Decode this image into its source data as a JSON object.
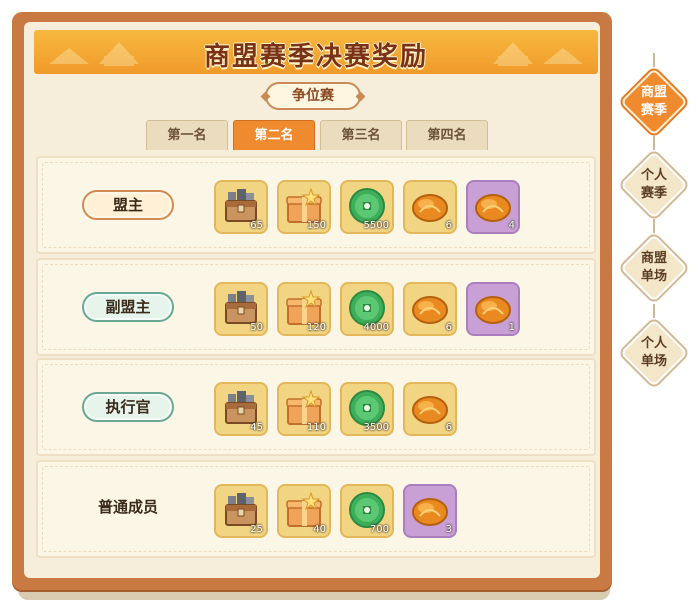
{
  "title": "商盟赛季决赛奖励",
  "mode_label": "争位赛",
  "tabs": [
    {
      "label": "第一名",
      "active": false
    },
    {
      "label": "第二名",
      "active": true
    },
    {
      "label": "第三名",
      "active": false
    },
    {
      "label": "第四名",
      "active": false
    }
  ],
  "side_tabs": [
    {
      "line1": "商盟",
      "line2": "赛季",
      "active": true
    },
    {
      "line1": "个人",
      "line2": "赛季",
      "active": false
    },
    {
      "line1": "商盟",
      "line2": "单场",
      "active": false
    },
    {
      "line1": "个人",
      "line2": "单场",
      "active": false
    }
  ],
  "rows": [
    {
      "role": "盟主",
      "badge": "gold",
      "items": [
        {
          "icon": "treasure-chest-icon",
          "qty": "65"
        },
        {
          "icon": "gift-box-icon",
          "qty": "150"
        },
        {
          "icon": "jade-coin-icon",
          "qty": "5500"
        },
        {
          "icon": "amber-stone-icon",
          "qty": "6"
        },
        {
          "icon": "amber-stone-rare-icon",
          "qty": "4"
        }
      ]
    },
    {
      "role": "副盟主",
      "badge": "teal",
      "items": [
        {
          "icon": "treasure-chest-icon",
          "qty": "50"
        },
        {
          "icon": "gift-box-icon",
          "qty": "120"
        },
        {
          "icon": "jade-coin-icon",
          "qty": "4000"
        },
        {
          "icon": "amber-stone-icon",
          "qty": "6"
        },
        {
          "icon": "amber-stone-rare-icon",
          "qty": "1"
        }
      ]
    },
    {
      "role": "执行官",
      "badge": "teal",
      "items": [
        {
          "icon": "treasure-chest-icon",
          "qty": "45"
        },
        {
          "icon": "gift-box-icon",
          "qty": "110"
        },
        {
          "icon": "jade-coin-icon",
          "qty": "3500"
        },
        {
          "icon": "amber-stone-icon",
          "qty": "6"
        }
      ]
    },
    {
      "role": "普通成员",
      "badge": "plain",
      "items": [
        {
          "icon": "treasure-chest-icon",
          "qty": "25"
        },
        {
          "icon": "gift-box-icon",
          "qty": "40"
        },
        {
          "icon": "jade-coin-icon",
          "qty": "700"
        },
        {
          "icon": "amber-stone-rare-icon",
          "qty": "3"
        }
      ]
    }
  ],
  "colors": {
    "frame": "#c97a42",
    "banner": "#f4a733",
    "active_tab": "#f08a2e",
    "paper": "#f6eedb"
  }
}
